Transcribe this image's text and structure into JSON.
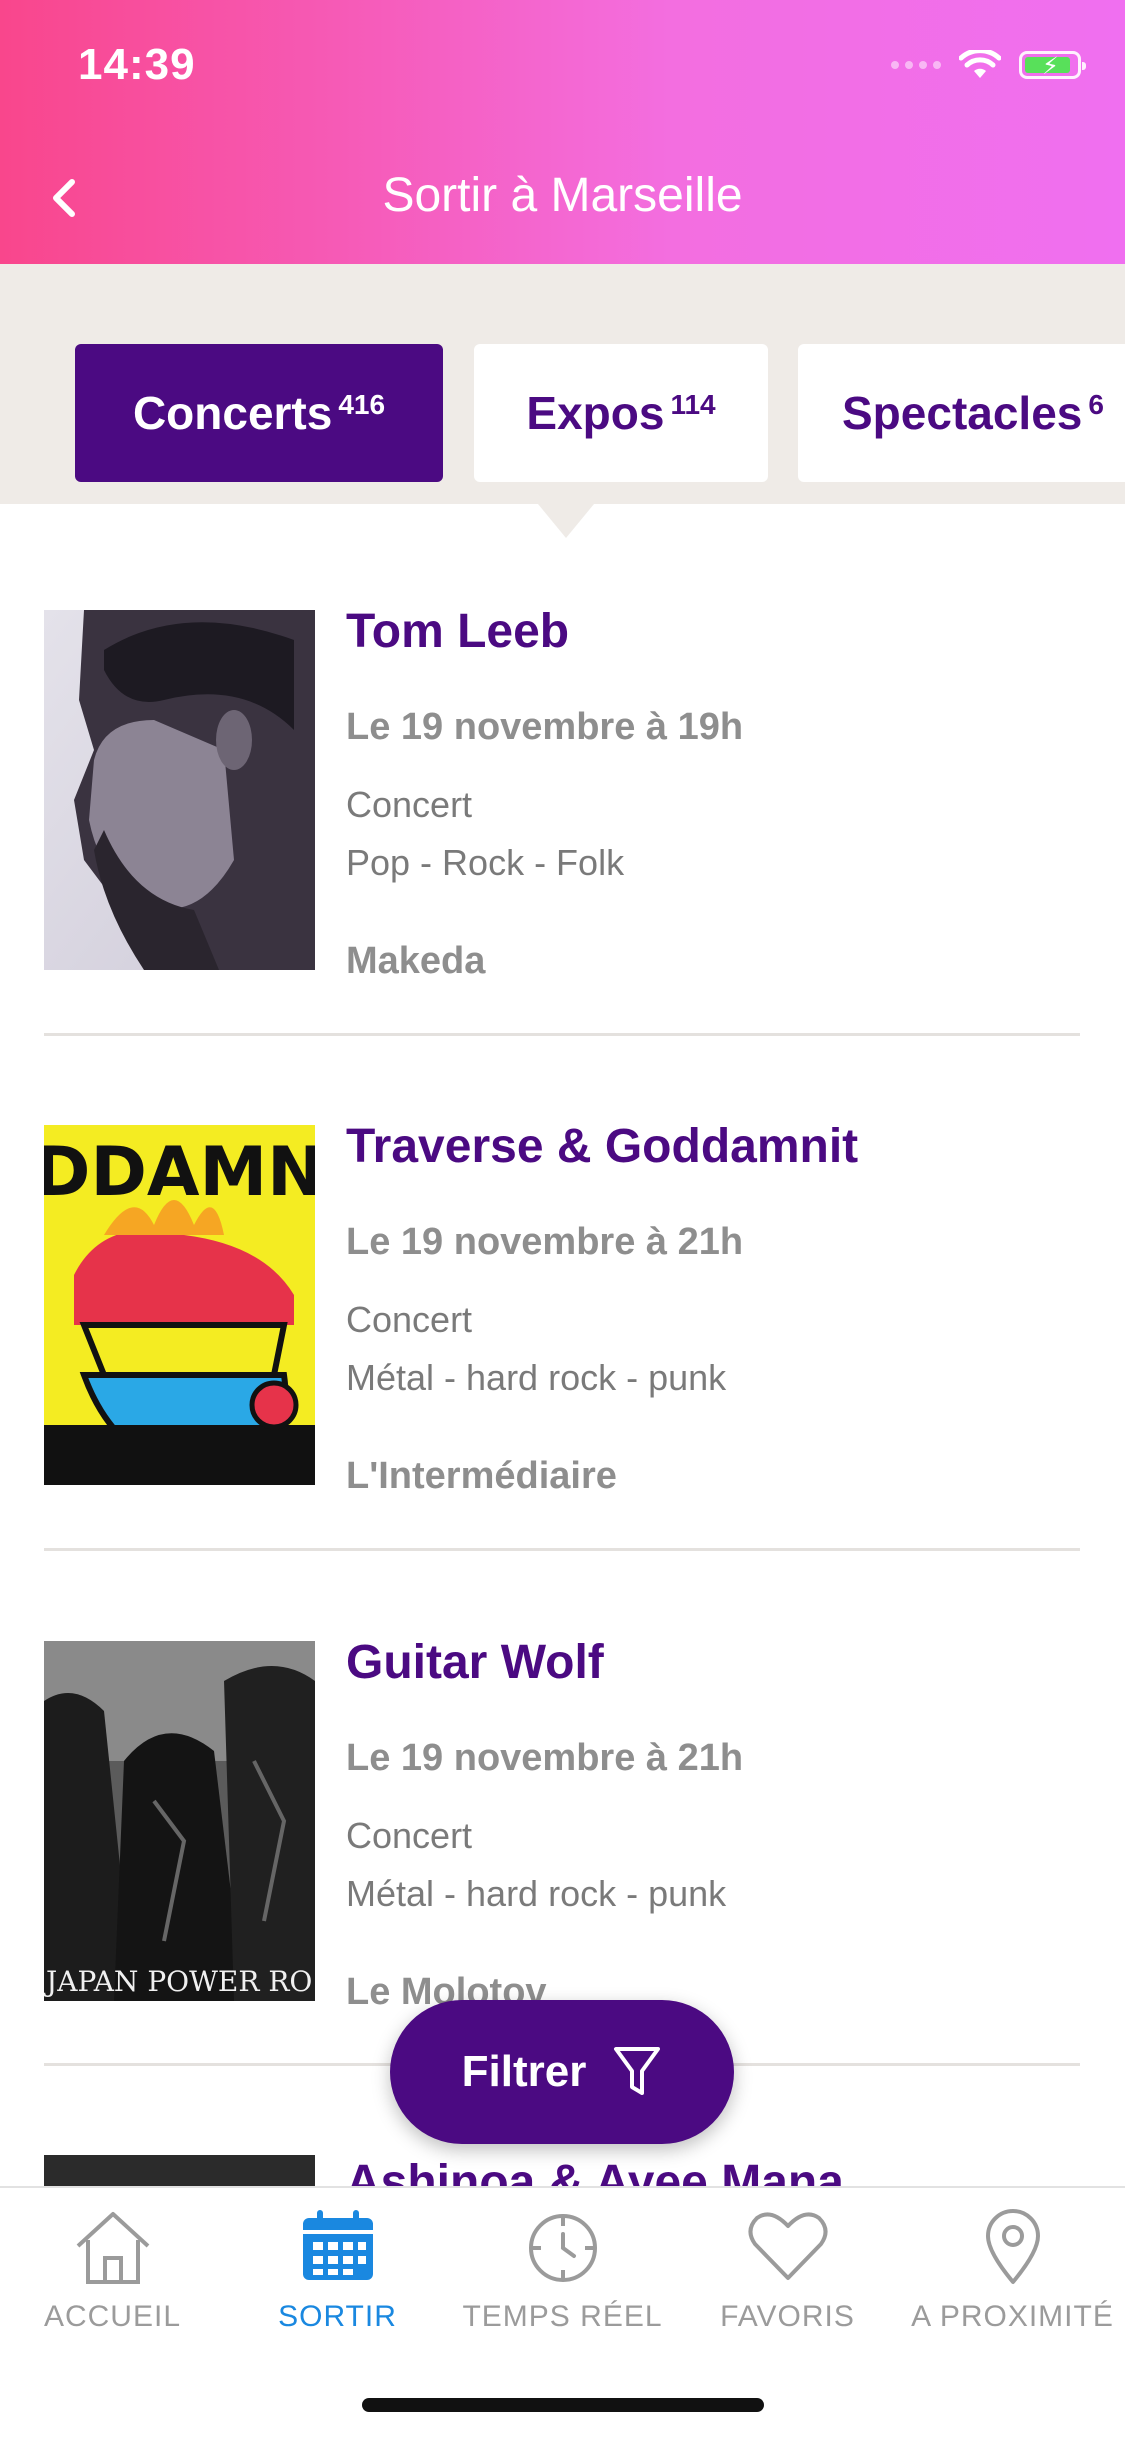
{
  "status_bar": {
    "time": "14:39"
  },
  "header": {
    "title": "Sortir à Marseille"
  },
  "tabs": [
    {
      "label": "Concerts",
      "count": "416",
      "active": true
    },
    {
      "label": "Expos",
      "count": "114",
      "active": false
    },
    {
      "label": "Spectacles",
      "count": "6",
      "active": false
    }
  ],
  "events": [
    {
      "title": "Tom Leeb",
      "date": "Le 19 novembre à 19h",
      "type": "Concert",
      "genre": "Pop - Rock - Folk",
      "venue": "Makeda"
    },
    {
      "title": "Traverse & Goddamnit",
      "date": "Le 19 novembre à 21h",
      "type": "Concert",
      "genre": "Métal - hard rock - punk",
      "venue": "L'Intermédiaire",
      "image_text": "DDAMNIT"
    },
    {
      "title": "Guitar Wolf",
      "date": "Le 19 novembre à 21h",
      "type": "Concert",
      "genre": "Métal - hard rock - punk",
      "venue": "Le Molotov",
      "image_text": "JAPAN POWER RO"
    },
    {
      "title": "Ashinoa & Ayee Mana"
    }
  ],
  "filter_button": {
    "label": "Filtrer"
  },
  "bottom_nav": [
    {
      "label": "ACCUEIL",
      "icon": "home-icon",
      "active": false
    },
    {
      "label": "SORTIR",
      "icon": "calendar-icon",
      "active": true
    },
    {
      "label": "TEMPS RÉEL",
      "icon": "clock-icon",
      "active": false
    },
    {
      "label": "FAVORIS",
      "icon": "heart-icon",
      "active": false
    },
    {
      "label": "A PROXIMITÉ",
      "icon": "location-pin-icon",
      "active": false
    }
  ],
  "colors": {
    "brand_purple": "#4b0a82",
    "header_pink": "#f9468c",
    "active_nav_blue": "#1a88e0"
  }
}
